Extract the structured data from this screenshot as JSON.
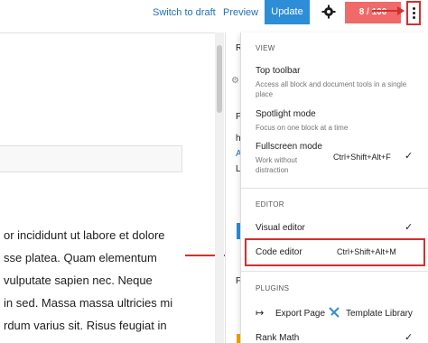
{
  "topbar": {
    "switch_to_draft": "Switch to draft",
    "preview": "Preview",
    "update": "Update",
    "rank_math_score": "8 / 100"
  },
  "editor": {
    "paragraph_lines": [
      "or incididunt ut labore et dolore",
      "sse platea. Quam elementum",
      "vulputate sapien nec. Neque",
      "in sed. Massa massa ultricies mi",
      "rdum varius sit. Risus feugiat in"
    ]
  },
  "sidebar_peek": {
    "r1": "R",
    "r2": "P",
    "r3": "h",
    "r4": "A",
    "r5": "L",
    "r6": "F"
  },
  "menu": {
    "view_label": "VIEW",
    "top_toolbar_title": "Top toolbar",
    "top_toolbar_desc": "Access all block and document tools in a single place",
    "spotlight_title": "Spotlight mode",
    "spotlight_desc": "Focus on one block at a time",
    "fullscreen_title": "Fullscreen mode",
    "fullscreen_desc": "Work without distraction",
    "fullscreen_shortcut": "Ctrl+Shift+Alt+F",
    "editor_label": "EDITOR",
    "visual_editor": "Visual editor",
    "code_editor": "Code editor",
    "code_editor_shortcut": "Ctrl+Shift+Alt+M",
    "plugins_label": "PLUGINS",
    "export_page": "Export Page",
    "template_library": "Template Library",
    "rank_math": "Rank Math",
    "check": "✓"
  },
  "colors": {
    "accent": "#2d8dd6",
    "annotation": "#d32f2f",
    "rank_math_badge": "#f06a6a"
  },
  "icons": [
    "gear-icon",
    "kebab-menu-icon",
    "export-icon",
    "template-library-icon",
    "check-icon"
  ]
}
